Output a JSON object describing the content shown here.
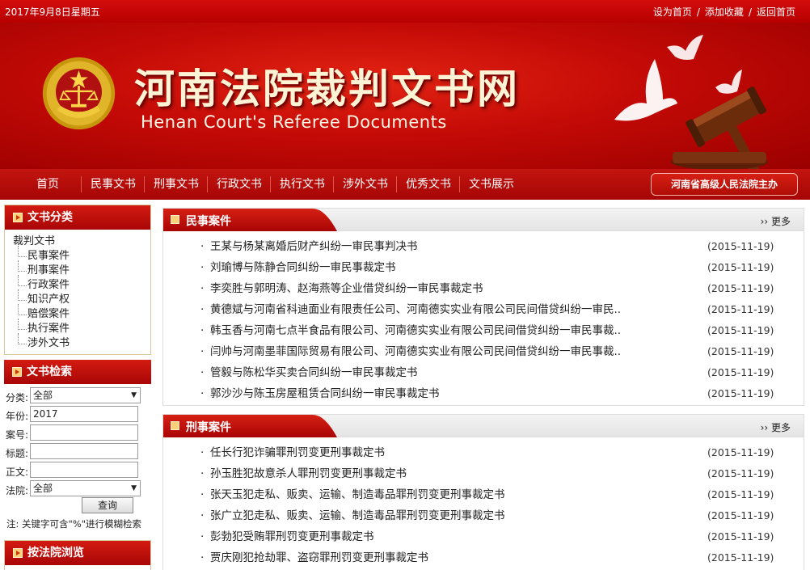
{
  "topbar": {
    "date": "2017年9月8日星期五",
    "links": [
      "设为首页",
      "添加收藏",
      "返回首页"
    ],
    "separator": "/"
  },
  "banner": {
    "title_cn": "河南法院裁判文书网",
    "title_en": "Henan   Court's Referee Documents",
    "emblem_icon": "court-emblem-icon",
    "decor_icon": "gavel-doves-icon"
  },
  "nav": {
    "items": [
      "首页",
      "民事文书",
      "刑事文书",
      "行政文书",
      "执行文书",
      "涉外文书",
      "优秀文书",
      "文书展示"
    ],
    "sponsor": "河南省高级人民法院主办"
  },
  "sidebar": {
    "category": {
      "title": "文书分类",
      "root": "裁判文书",
      "items": [
        "民事案件",
        "刑事案件",
        "行政案件",
        "知识产权",
        "赔偿案件",
        "执行案件",
        "涉外文书"
      ]
    },
    "search": {
      "title": "文书检索",
      "fields": [
        {
          "label": "分类:",
          "value": "全部",
          "type": "select"
        },
        {
          "label": "年份:",
          "value": "2017",
          "type": "input"
        },
        {
          "label": "案号:",
          "value": "",
          "type": "input"
        },
        {
          "label": "标题:",
          "value": "",
          "type": "input"
        },
        {
          "label": "正文:",
          "value": "",
          "type": "input"
        },
        {
          "label": "法院:",
          "value": "全部",
          "type": "select"
        }
      ],
      "button": "查询",
      "hint": "注: 关键字可含\"%\"进行模糊检索"
    },
    "browse": {
      "title": "按法院浏览"
    }
  },
  "panels": [
    {
      "title": "民事案件",
      "more": "›› 更多",
      "bullet": "·",
      "rows": [
        {
          "title": "王某与杨某离婚后财产纠纷一审民事判决书",
          "date": "(2015-11-19)"
        },
        {
          "title": "刘瑜博与陈静合同纠纷一审民事裁定书",
          "date": "(2015-11-19)"
        },
        {
          "title": "李奕胜与郭明涛、赵海燕等企业借贷纠纷一审民事裁定书",
          "date": "(2015-11-19)"
        },
        {
          "title": "黄德斌与河南省科迪面业有限责任公司、河南德实实业有限公司民间借贷纠纷一审民..",
          "date": "(2015-11-19)"
        },
        {
          "title": "韩玉香与河南七点半食品有限公司、河南德实实业有限公司民间借贷纠纷一审民事裁..",
          "date": "(2015-11-19)"
        },
        {
          "title": "闫帅与河南墨菲国际贸易有限公司、河南德实实业有限公司民间借贷纠纷一审民事裁..",
          "date": "(2015-11-19)"
        },
        {
          "title": "管毅与陈松华买卖合同纠纷一审民事裁定书",
          "date": "(2015-11-19)"
        },
        {
          "title": "郭沙沙与陈玉房屋租赁合同纠纷一审民事裁定书",
          "date": "(2015-11-19)"
        }
      ]
    },
    {
      "title": "刑事案件",
      "more": "›› 更多",
      "bullet": "·",
      "rows": [
        {
          "title": "任长行犯诈骗罪刑罚变更刑事裁定书",
          "date": "(2015-11-19)"
        },
        {
          "title": "孙玉胜犯故意杀人罪刑罚变更刑事裁定书",
          "date": "(2015-11-19)"
        },
        {
          "title": "张天玉犯走私、贩卖、运输、制造毒品罪刑罚变更刑事裁定书",
          "date": "(2015-11-19)"
        },
        {
          "title": "张广立犯走私、贩卖、运输、制造毒品罪刑罚变更刑事裁定书",
          "date": "(2015-11-19)"
        },
        {
          "title": "彭勃犯受贿罪刑罚变更刑事裁定书",
          "date": "(2015-11-19)"
        },
        {
          "title": "贾庆刚犯抢劫罪、盗窃罪刑罚变更刑事裁定书",
          "date": "(2015-11-19)"
        }
      ]
    }
  ],
  "colors": {
    "brand_red": "#c40a06",
    "title_cream": "#fff3d6"
  }
}
